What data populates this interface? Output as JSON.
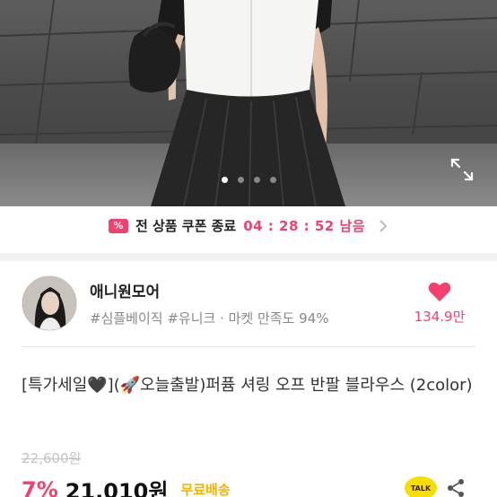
{
  "photo": {
    "alt_icon": "product-photo",
    "dots": [
      true,
      false,
      false,
      false
    ],
    "expand_icon": "expand-icon"
  },
  "coupon": {
    "icon_glyph": "%",
    "text": "전 상품 쿠폰 종료",
    "timer": "04 : 28 : 52 남음",
    "chevron_icon": "chevron-right-icon"
  },
  "shop": {
    "name": "애니원모어",
    "tags": [
      "#심플베이직",
      "#유니크"
    ],
    "separator": " · ",
    "satisfaction": "마켓 만족도 94%",
    "like_count": "134.9만"
  },
  "product": {
    "title": "[특가세일🖤](🚀오늘출발)퍼퓸 셔링 오프 반팔 블라우스 (2color)",
    "original_price": "22,600원",
    "discount": "7%",
    "price": "21,010원",
    "shipping": "무료배송"
  },
  "actions": {
    "talk_label": "TALK",
    "share_icon": "share-icon"
  },
  "colors": {
    "accent": "#f2416f",
    "shipping": "#f0b400",
    "kakao": "#f6df00"
  }
}
